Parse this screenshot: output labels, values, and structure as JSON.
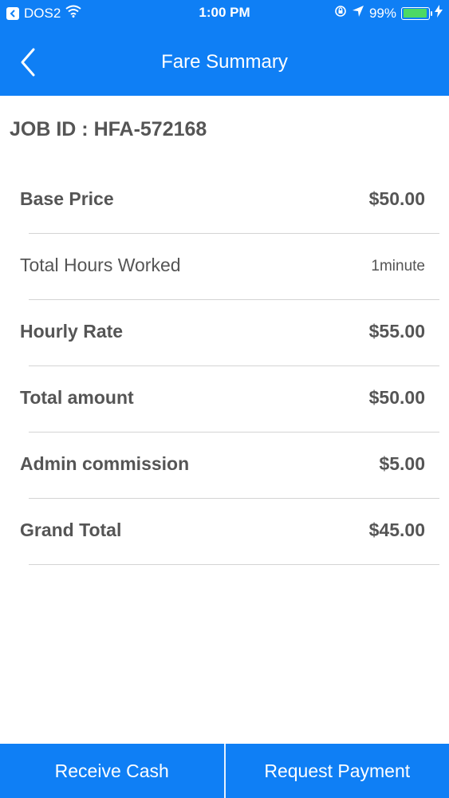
{
  "status_bar": {
    "carrier": "DOS2",
    "time": "1:00 PM",
    "battery": "99%"
  },
  "header": {
    "title": "Fare Summary"
  },
  "job": {
    "id_text": "JOB ID : HFA-572168"
  },
  "fare_rows": [
    {
      "label": "Base Price",
      "value": "$50.00"
    },
    {
      "label": "Total Hours Worked",
      "value": "1minute"
    },
    {
      "label": "Hourly Rate",
      "value": "$55.00"
    },
    {
      "label": "Total amount",
      "value": "$50.00"
    },
    {
      "label": "Admin commission",
      "value": "$5.00"
    },
    {
      "label": "Grand Total",
      "value": "$45.00"
    }
  ],
  "actions": {
    "receive_cash": "Receive Cash",
    "request_payment": "Request Payment"
  },
  "colors": {
    "primary": "#0f7ff5",
    "text": "#555555",
    "divider": "#d4d4d4",
    "battery": "#4cd964"
  },
  "icons": {
    "back": "chevron-left-icon",
    "wifi": "wifi-icon",
    "location": "location-arrow-icon",
    "lock_rotation": "rotation-lock-icon",
    "charging": "bolt-icon"
  }
}
